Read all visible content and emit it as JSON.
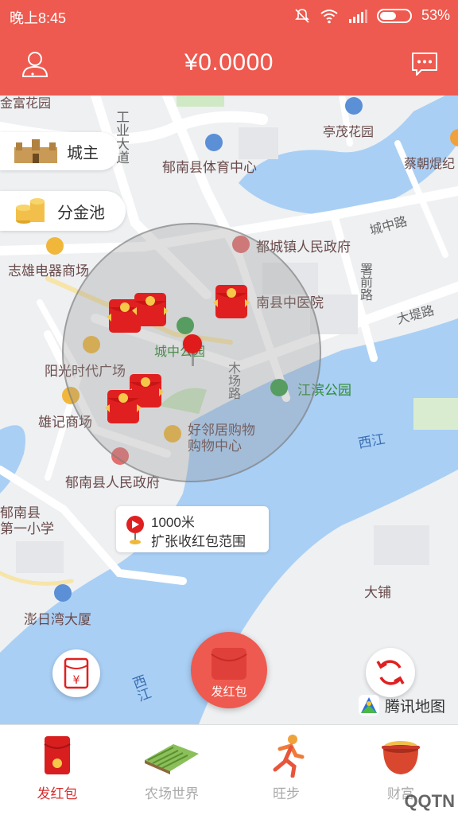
{
  "status_bar": {
    "time": "晚上8:45",
    "battery": "53%"
  },
  "header": {
    "balance": "¥0.0000",
    "user_icon": "user-icon",
    "message_icon": "message-icon"
  },
  "side_buttons": {
    "city_lord": "城主",
    "gold_pool": "分金池"
  },
  "map": {
    "labels": {
      "jinfu": "金富花园",
      "gongye": "工业大道",
      "tingmao": "亭茂花园",
      "caichao": "蔡朝焜纪",
      "sports": "郁南县体育中心",
      "chengzhong_road": "城中路",
      "government": "都城镇人民政府",
      "zhixiong": "志雄电器商场",
      "shu": "署前路",
      "hospital": "南县中医院",
      "dadi": "大堤路",
      "park": "城中公园",
      "yangguang": "阳光时代广场",
      "mu": "木场路",
      "jiangbin": "江滨公园",
      "xiongji": "雄记商场",
      "haolinju1": "好邻居购物",
      "haolinju2": "购物中心",
      "xijiang1": "西江",
      "county_gov": "郁南县人民政府",
      "school1": "郁南县",
      "school2": "第一小学",
      "dapu": "大铺",
      "pengri": "澎日湾大厦",
      "xijiang2": "西江"
    },
    "range_tip": {
      "distance": "1000米",
      "action": "扩张收红包范围"
    },
    "main_button": "发红包",
    "provider": "腾讯地图"
  },
  "colors": {
    "brand": "#ee5a4f",
    "active_tab": "#d92f2f",
    "water": "#a9cff5"
  },
  "bottom_nav": {
    "tabs": [
      {
        "label": "发红包",
        "active": true
      },
      {
        "label": "农场世界",
        "active": false
      },
      {
        "label": "旺步",
        "active": false
      },
      {
        "label": "财富",
        "active": false
      }
    ]
  },
  "watermark": "QQTN"
}
